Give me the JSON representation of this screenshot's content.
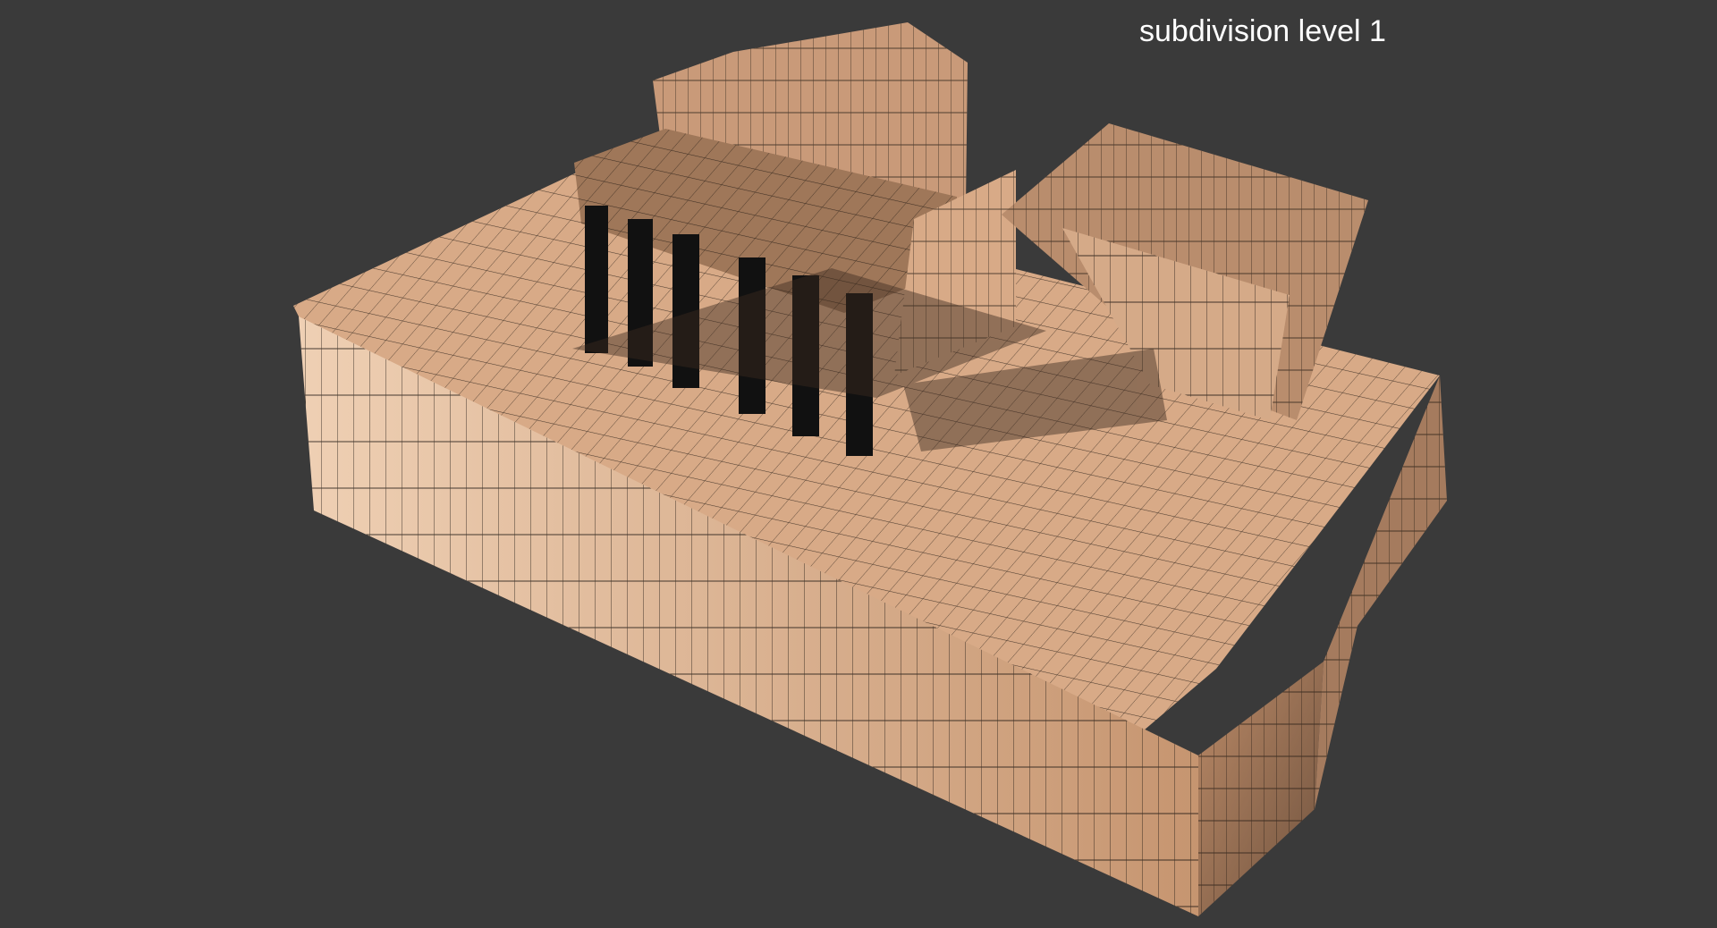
{
  "viewport": {
    "label": "subdivision level 1",
    "background_color": "#3a3a3a"
  },
  "model": {
    "mesh_color": "#d8aa87",
    "mesh_shadow_color": "#8f6d55",
    "wire_color": "#1c1510",
    "column_color": "#111111"
  }
}
